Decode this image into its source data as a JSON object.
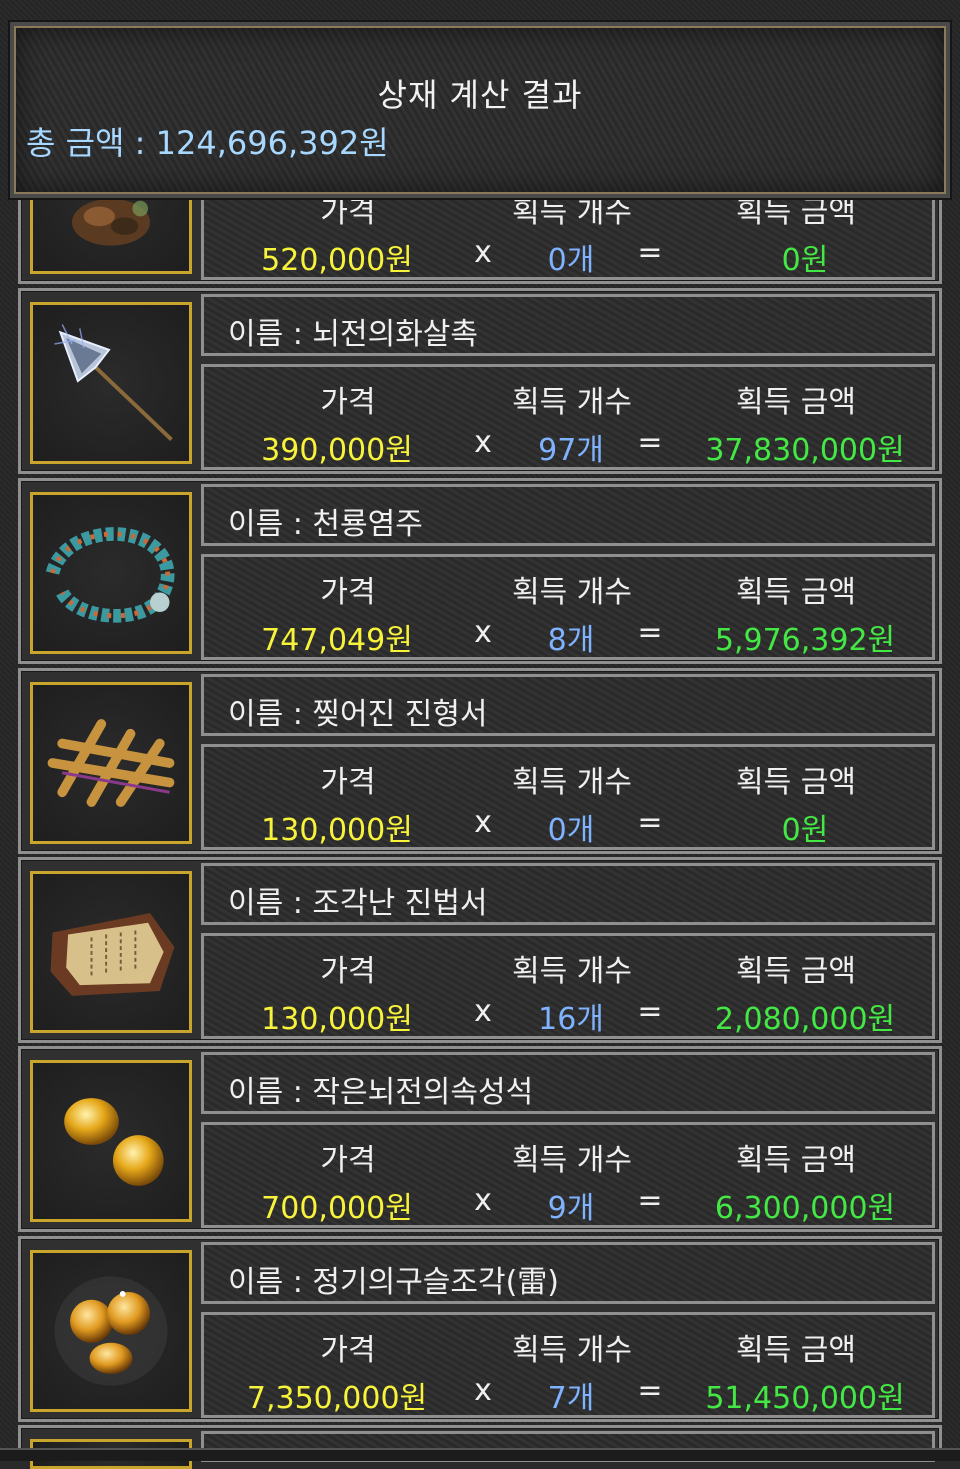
{
  "header": {
    "title": "상재 계산 결과",
    "total_label": "총 금액 : ",
    "total_value": "124,696,392원"
  },
  "labels": {
    "name_prefix": "이름 : ",
    "price": "가격",
    "count": "획득 개수",
    "amount": "획득 금액",
    "multiply": "x",
    "equals": "="
  },
  "items": [
    {
      "name": "",
      "price": "520,000원",
      "count": "0개",
      "amount": "0원",
      "icon": "ore-icon"
    },
    {
      "name": "뇌전의화살촉",
      "price": "390,000원",
      "count": "97개",
      "amount": "37,830,000원",
      "icon": "spear-icon"
    },
    {
      "name": "천룡염주",
      "price": "747,049원",
      "count": "8개",
      "amount": "5,976,392원",
      "icon": "dragon-beads-icon"
    },
    {
      "name": "찢어진 진형서",
      "price": "130,000원",
      "count": "0개",
      "amount": "0원",
      "icon": "wood-fence-icon"
    },
    {
      "name": "조각난 진법서",
      "price": "130,000원",
      "count": "16개",
      "amount": "2,080,000원",
      "icon": "scroll-icon"
    },
    {
      "name": "작은뇌전의속성석",
      "price": "700,000원",
      "count": "9개",
      "amount": "6,300,000원",
      "icon": "gold-stones-icon"
    },
    {
      "name": "정기의구슬조각(雷)",
      "price": "7,350,000원",
      "count": "7개",
      "amount": "51,450,000원",
      "icon": "gold-orbs-icon"
    }
  ],
  "colors": {
    "price": "#f7f23a",
    "count": "#7fb2ff",
    "amount": "#44e844",
    "total": "#a8d8ff",
    "frame_gold": "#c9a52c"
  }
}
